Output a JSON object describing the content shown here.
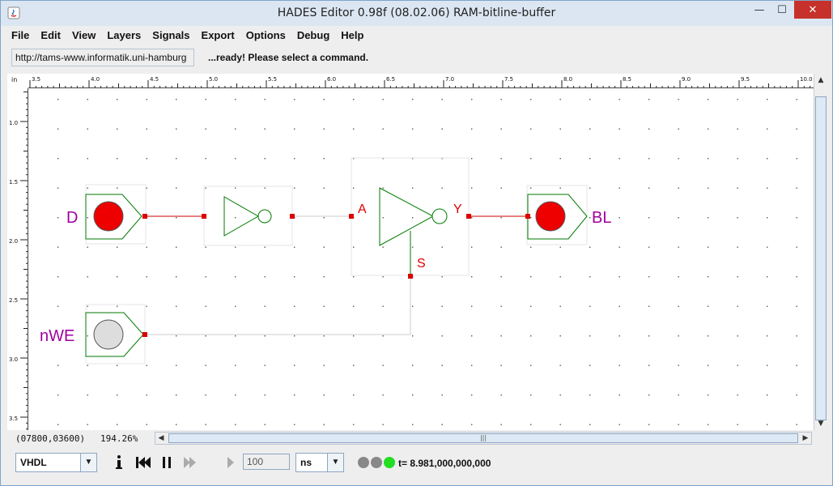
{
  "window": {
    "title": "HADES Editor 0.98f (08.02.06)   RAM-bitline-buffer",
    "min_symbol": "—",
    "max_symbol": "☐",
    "close_symbol": "✕"
  },
  "menu": {
    "items": [
      "File",
      "Edit",
      "View",
      "Layers",
      "Signals",
      "Export",
      "Options",
      "Debug",
      "Help"
    ]
  },
  "toolbar": {
    "url": "http://tams-www.informatik.uni-hamburg",
    "status": "...ready! Please select a command."
  },
  "ruler": {
    "unit": "in",
    "h_labels": [
      "3.5",
      "4.0",
      "4.5",
      "5.0",
      "5.5",
      "6.0",
      "6.5",
      "7.0",
      "7.5",
      "8.0",
      "8.5",
      "9.0",
      "9.5",
      "10.0"
    ],
    "v_labels": [
      "1.0",
      "1.5",
      "2.0",
      "2.5",
      "3.0",
      "3.5"
    ]
  },
  "schematic": {
    "labels": {
      "input_d": "D",
      "input_nwe": "nWE",
      "output_bl": "BL",
      "pin_a": "A",
      "pin_y": "Y",
      "pin_s": "S"
    },
    "colors": {
      "component": "#007a00",
      "wire_active": "#cc0000",
      "wire_idle": "#c8c8c8",
      "label": "#a000a0",
      "pin_label": "#dd0000",
      "signal_high": "#ee0000",
      "signal_low": "#dddddd"
    }
  },
  "statusbar": {
    "coords": "(07800,03600)",
    "zoom": "194.26%"
  },
  "controls": {
    "language": "VHDL",
    "time_value": "100",
    "time_unit": "ns",
    "sim_time": "t= 8.981,000,000,000",
    "led_colors": [
      "#888888",
      "#888888",
      "#22dd22"
    ]
  }
}
